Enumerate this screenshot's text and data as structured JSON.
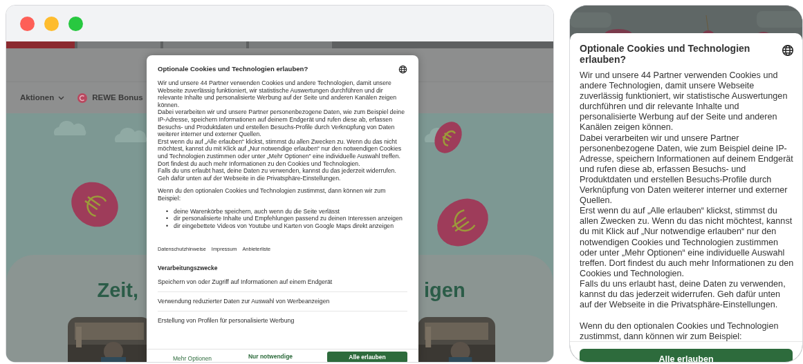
{
  "desktop": {
    "page": {
      "tabs": [
        {
          "selected": true
        },
        {
          "selected": false
        },
        {
          "selected": false
        },
        {
          "selected": false
        }
      ],
      "nav": [
        {
          "label": "Aktionen",
          "kind": "dropdown"
        },
        {
          "label": "REWE Bonus",
          "kind": "bonus"
        }
      ],
      "heading_left": "Zeit,",
      "heading_right": "igen"
    },
    "dialog": {
      "title": "Optionale Cookies und Technologien erlauben?",
      "paragraphs": [
        "Wir und unsere 44 Partner verwenden Cookies und andere Technologien, damit unsere Webseite zuverlässig funktioniert, wir statistische Auswertungen durchführen und dir relevante Inhalte und personalisierte Werbung auf der Seite und anderen Kanälen zeigen können.",
        "Dabei verarbeiten wir und unsere Partner personenbezogene Daten, wie zum Beispiel deine IP-Adresse, speichern Informationen auf deinem Endgerät und rufen diese ab, erfassen Besuchs- und Produktdaten und erstellen Besuchs-Profile durch Verknüpfung von Daten weiterer interner und externer Quellen.",
        "Erst wenn du auf „Alle erlauben“ klickst, stimmst du allen Zwecken zu. Wenn du das nicht möchtest, kannst du mit Klick auf „Nur notwendige erlauben“ nur den notwendigen Cookies und Technologien zustimmen oder unter „Mehr Optionen“ eine individuelle Auswahl treffen. Dort findest du auch mehr Informationen zu den Cookies und Technologien.",
        "Falls du uns erlaubt hast, deine Daten zu verwenden, kannst du das jederzeit widerrufen. Geh dafür unten auf der Webseite in die Privatsphäre-Einstellungen."
      ],
      "lead": "Wenn du den optionalen Cookies und Technologien zustimmst, dann können wir zum Beispiel:",
      "marker": "•",
      "bullets": [
        "deine Warenkörbe speichern, auch wenn du die Seite verlässt",
        "dir personalisierte Inhalte und Empfehlungen passend zu deinen Interessen anzeigen",
        "dir eingebettete Videos von Youtube und Karten von Google Maps direkt anzeigen"
      ],
      "links": [
        "Datenschutzhinweise",
        "Impressum",
        "Anbieterliste"
      ],
      "purposes_title": "Verarbeitungszwecke",
      "purposes": [
        "Speichern von oder Zugriff auf Informationen auf einem Endgerät",
        "Verwendung reduzierter Daten zur Auswahl von Werbeanzeigen",
        "Erstellung von Profilen für personalisierte Werbung"
      ],
      "buttons": [
        {
          "label": "Mehr Optionen",
          "kind": "link"
        },
        {
          "label": "Nur notwendige",
          "kind": "secondary"
        },
        {
          "label": "Alle erlauben",
          "kind": "primary"
        }
      ]
    }
  },
  "mobile": {
    "dialog": {
      "title": "Optionale Cookies und Technologien erlauben?",
      "paragraphs": [
        "Wir und unsere 44 Partner verwenden Cookies und andere Technologien, damit unsere Webseite zuverlässig funktioniert, wir statistische Auswertungen durchführen und dir relevante Inhalte und personalisierte Werbung auf der Seite und anderen Kanälen zeigen können.",
        "Dabei verarbeiten wir und unsere Partner personenbezogene Daten, wie zum Beispiel deine IP-Adresse, speichern Informationen auf deinem Endgerät und rufen diese ab, erfassen Besuchs- und Produktdaten und erstellen Besuchs-Profile durch Verknüpfung von Daten weiterer interner und externer Quellen.",
        "Erst wenn du auf „Alle erlauben“ klickst, stimmst du allen Zwecken zu. Wenn du das nicht möchtest, kannst du mit Klick auf „Nur notwendige erlauben“ nur den notwendigen Cookies und Technologien zustimmen oder unter „Mehr Optionen“ eine individuelle Auswahl treffen. Dort findest du auch mehr Informationen zu den Cookies und Technologien.",
        "Falls du uns erlaubt hast, deine Daten zu verwenden, kannst du das jederzeit widerrufen. Geh dafür unten auf der Webseite in die Privatsphäre-Einstellungen."
      ],
      "lead": "Wenn du den optionalen Cookies und Technologien zustimmst, dann können wir zum Beispiel:",
      "buttons": [
        {
          "label": "Alle erlauben",
          "kind": "primary"
        }
      ]
    }
  }
}
